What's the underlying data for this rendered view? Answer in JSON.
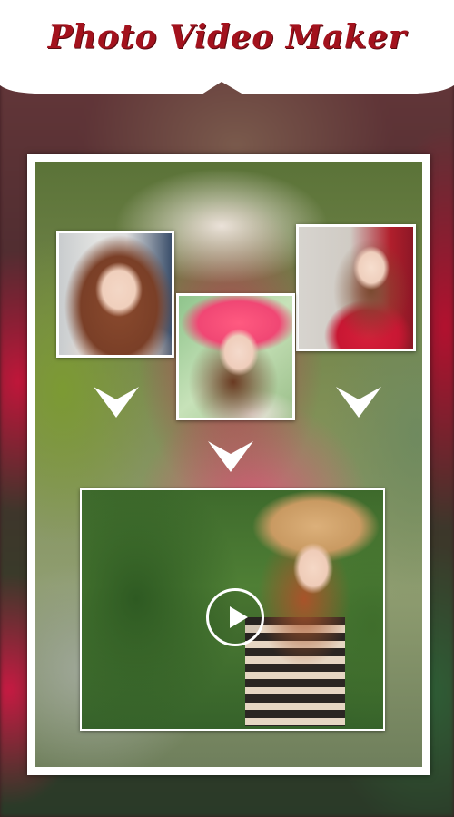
{
  "header": {
    "title": "Photo Video Maker"
  },
  "colors": {
    "title": "#a3121d",
    "header_background": "#ffffff",
    "frame_border": "#ffffff"
  },
  "icons": {
    "arrow": "chevron-down-icon",
    "play": "play-icon"
  },
  "photos": [
    {
      "name": "photo-1"
    },
    {
      "name": "photo-2"
    },
    {
      "name": "photo-3"
    }
  ]
}
